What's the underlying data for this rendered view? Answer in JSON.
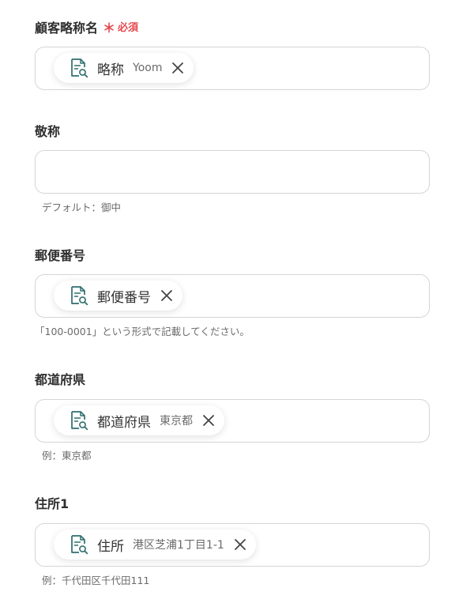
{
  "fields": [
    {
      "label": "顧客略称名",
      "required_mark": "＊",
      "required_text": "必須",
      "chip": {
        "name": "略称",
        "sample": "Yoom"
      }
    },
    {
      "label": "敬称",
      "helper": "デフォルト：御中"
    },
    {
      "label": "郵便番号",
      "chip": {
        "name": "郵便番号"
      },
      "helper": "「100-0001」という形式で記載してください。"
    },
    {
      "label": "都道府県",
      "chip": {
        "name": "都道府県",
        "sample": "東京都"
      },
      "helper": "例：東京都"
    },
    {
      "label": "住所1",
      "chip": {
        "name": "住所",
        "sample": "港区芝浦1丁目1-1"
      },
      "helper": "例：千代田区千代田111"
    }
  ],
  "icons": {
    "chip_icon": "document-search-icon",
    "remove_icon": "close-icon"
  },
  "colors": {
    "required": "#e5484d",
    "icon": "#2f6f6d",
    "border": "#d5d5d5"
  }
}
